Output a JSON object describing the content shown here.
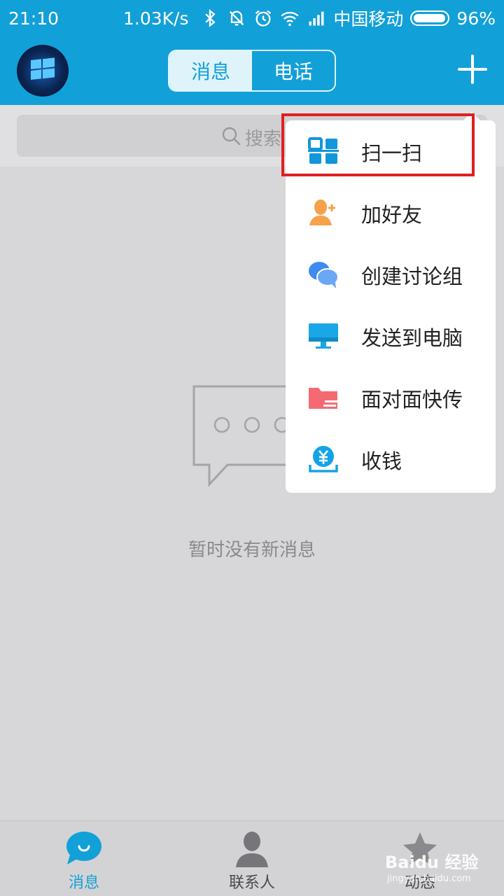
{
  "status_bar": {
    "time": "21:10",
    "network_speed": "1.03K/s",
    "carrier": "中国移动",
    "battery": "96%",
    "battery_level": 0.96
  },
  "header": {
    "tabs": [
      {
        "label": "消息",
        "active": true
      },
      {
        "label": "电话",
        "active": false
      }
    ],
    "plus_icon": "plus-icon"
  },
  "search": {
    "placeholder": "搜索"
  },
  "empty_state": {
    "text": "暂时没有新消息"
  },
  "menu": {
    "items": [
      {
        "label": "扫一扫",
        "icon": "qr-scan-icon",
        "color": "#1296db"
      },
      {
        "label": "加好友",
        "icon": "add-friend-icon",
        "color": "#f5a24a"
      },
      {
        "label": "创建讨论组",
        "icon": "discussion-group-icon",
        "color": "#3f8bf0"
      },
      {
        "label": "发送到电脑",
        "icon": "monitor-icon",
        "color": "#1aa7e6"
      },
      {
        "label": "面对面快传",
        "icon": "folder-transfer-icon",
        "color": "#f56a72"
      },
      {
        "label": "收钱",
        "icon": "receive-money-icon",
        "color": "#14a3e6"
      }
    ],
    "highlighted": "扫一扫"
  },
  "tab_bar": {
    "items": [
      {
        "label": "消息",
        "icon": "chat-bubble-icon",
        "active": true
      },
      {
        "label": "联系人",
        "icon": "contacts-icon",
        "active": false
      },
      {
        "label": "动态",
        "icon": "star-icon",
        "active": false
      }
    ]
  },
  "watermark": {
    "text": "Baidu 经验",
    "url": "jingyan.baidu.com"
  },
  "colors": {
    "accent": "#12a0d8",
    "highlight_border": "#e02020"
  }
}
